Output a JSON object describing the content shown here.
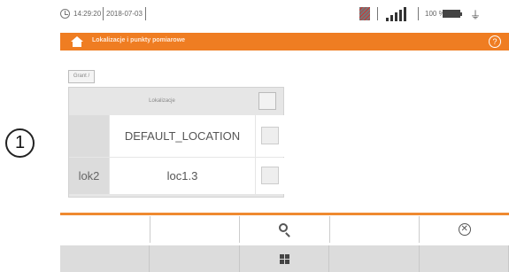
{
  "callout": "1",
  "status": {
    "time": "14:29:20",
    "date": "2018-07-03",
    "battery": "100 %"
  },
  "titlebar": {
    "title": "Lokalizacje i punkty pomiarowe",
    "help": "?"
  },
  "breadcrumb": "Grant /",
  "table": {
    "header": "Lokalizacje",
    "rows": [
      {
        "label": "",
        "value": "DEFAULT_LOCATION"
      },
      {
        "label": "lok2",
        "value": "loc1.3"
      }
    ]
  },
  "toolbar": {
    "row1": [
      "",
      "",
      "search-icon",
      "",
      "cancel-icon"
    ],
    "row2": [
      "",
      "",
      "grid-icon",
      "",
      ""
    ]
  },
  "colors": {
    "accent": "#ef7d22",
    "table_bg": "#e6e6e6",
    "toolbar_bg": "#dcdcdc"
  }
}
